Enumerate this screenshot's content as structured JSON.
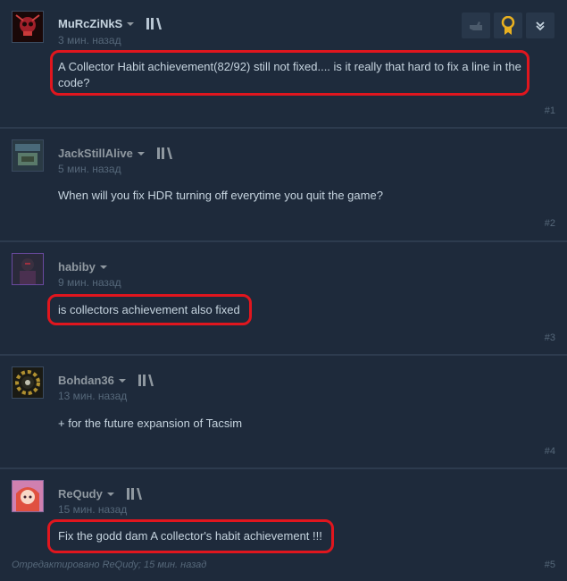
{
  "comments": [
    {
      "author": "MuRcZiNkS",
      "time": "3 мин. назад",
      "text_line1": "A Collector Habit achievement(82/92) still not fixed.... is it really that hard to fix a line in the",
      "text_line2": "code?",
      "number": "#1",
      "has_library_icon": true,
      "avatar": "skull-avatar"
    },
    {
      "author": "JackStillAlive",
      "time": "5 мин. назад",
      "text": "When will you fix HDR turning off everytime you quit the game?",
      "number": "#2",
      "has_library_icon": true,
      "avatar": "game-art-avatar"
    },
    {
      "author": "habiby",
      "time": "9 мин. назад",
      "text": "is collectors achievement also fixed",
      "number": "#3",
      "has_library_icon": false,
      "avatar": "dark-figure-avatar"
    },
    {
      "author": "Bohdan36",
      "time": "13 мин. назад",
      "text": "+ for the future expansion of Tacsim",
      "number": "#4",
      "has_library_icon": true,
      "avatar": "cog-emblem-avatar"
    },
    {
      "author": "ReQudy",
      "time": "15 мин. назад",
      "text": "Fix the godd dam A collector's habit achievement !!!",
      "number": "#5",
      "has_library_icon": true,
      "edited": "Отредактировано ReQudy; 15 мин. назад",
      "avatar": "anime-girl-avatar"
    }
  ],
  "toolbar": {
    "icons": [
      "thumb-icon",
      "award-icon",
      "expand-icon"
    ]
  },
  "colors": {
    "background": "#1d2838",
    "text": "#c6d4df",
    "muted": "#56687a",
    "highlight": "#e0161e",
    "award": "#e8b020"
  }
}
